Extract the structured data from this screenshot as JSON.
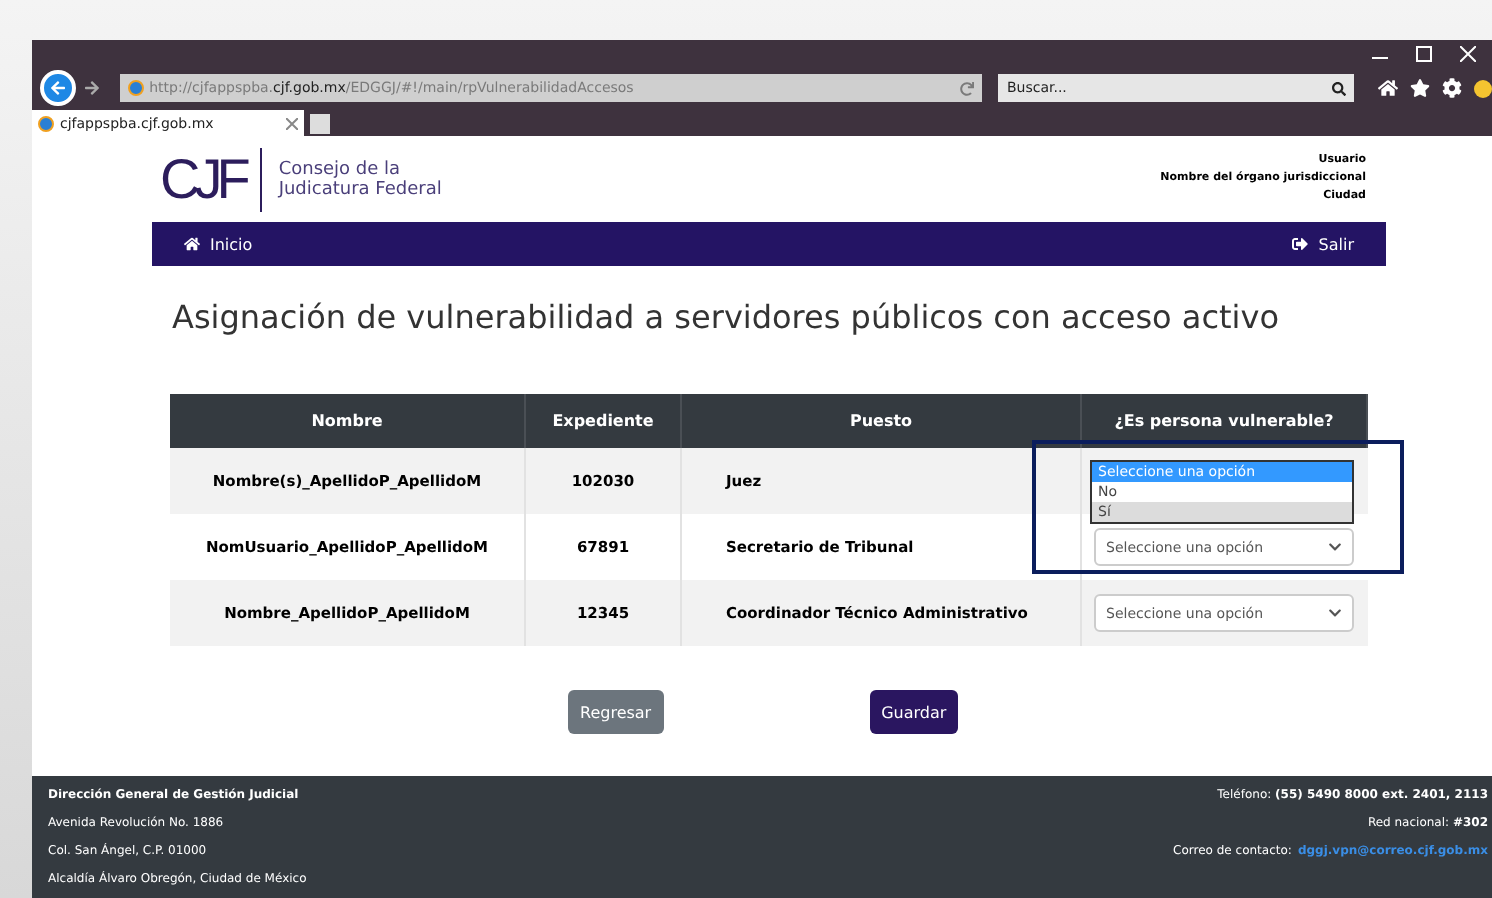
{
  "browser": {
    "url": "http://cjfappspba.**cjf.gob.mx**/EDGGJ/#!/main/rpVulnerabilidadAccesos",
    "search_placeholder": "Buscar...",
    "tabs": [
      {
        "title": "cjfappspba.cjf.gob.mx",
        "selected": true
      }
    ]
  },
  "header": {
    "logo": "CJF",
    "org_line1": "Consejo de la",
    "org_line2": "Judicatura Federal",
    "user_lines": [
      "Usuario",
      "Nombre del órgano jurisdiccional",
      "Ciudad"
    ]
  },
  "nav": {
    "home": "Inicio",
    "logout": "Salir"
  },
  "title": "Asignación de vulnerabilidad a servidores públicos con acceso activo",
  "table": {
    "columns": [
      "Nombre",
      "Expediente",
      "Puesto",
      "¿Es persona vulnerable?"
    ],
    "rows": [
      {
        "name": "Nombre(s)_ApellidoP_ApellidoM",
        "file": "102030",
        "position": "Juez",
        "select": {
          "expanded": true,
          "options": [
            {
              "label": "Seleccione una opción",
              "selected": true,
              "hovered": false
            },
            {
              "label": "No",
              "selected": false,
              "hovered": false
            },
            {
              "label": "Sí",
              "selected": false,
              "hovered": true
            }
          ]
        }
      },
      {
        "name": "NomUsuario_ApellidoP_ApellidoM",
        "file": "67891",
        "position": "Secretario de Tribunal",
        "select": {
          "value": "Seleccione una opción",
          "expanded": false
        }
      },
      {
        "name": "Nombre_ApellidoP_ApellidoM",
        "file": "12345",
        "position": "Coordinador Técnico Administrativo",
        "select": {
          "value": "Seleccione una opción",
          "expanded": false
        }
      }
    ]
  },
  "buttons": [
    {
      "label": "Regresar",
      "kind": "secondary"
    },
    {
      "label": "Guardar",
      "kind": "primary"
    }
  ],
  "footer": {
    "left": [
      "**Dirección General de Gestión Judicial**",
      "Avenida Revolución No. 1886",
      "Col. San Ángel, C.P. 01000",
      "Alcaldía Álvaro Obregón, Ciudad de México"
    ],
    "right": [
      "Teléfono: **(55) 5490 8000 ext. 2401, 2113**",
      "Red nacional: **#302**"
    ],
    "contact_label": "Correo de contacto:",
    "contact_email": "dggj.vpn@correo.cjf.gob.mx"
  }
}
